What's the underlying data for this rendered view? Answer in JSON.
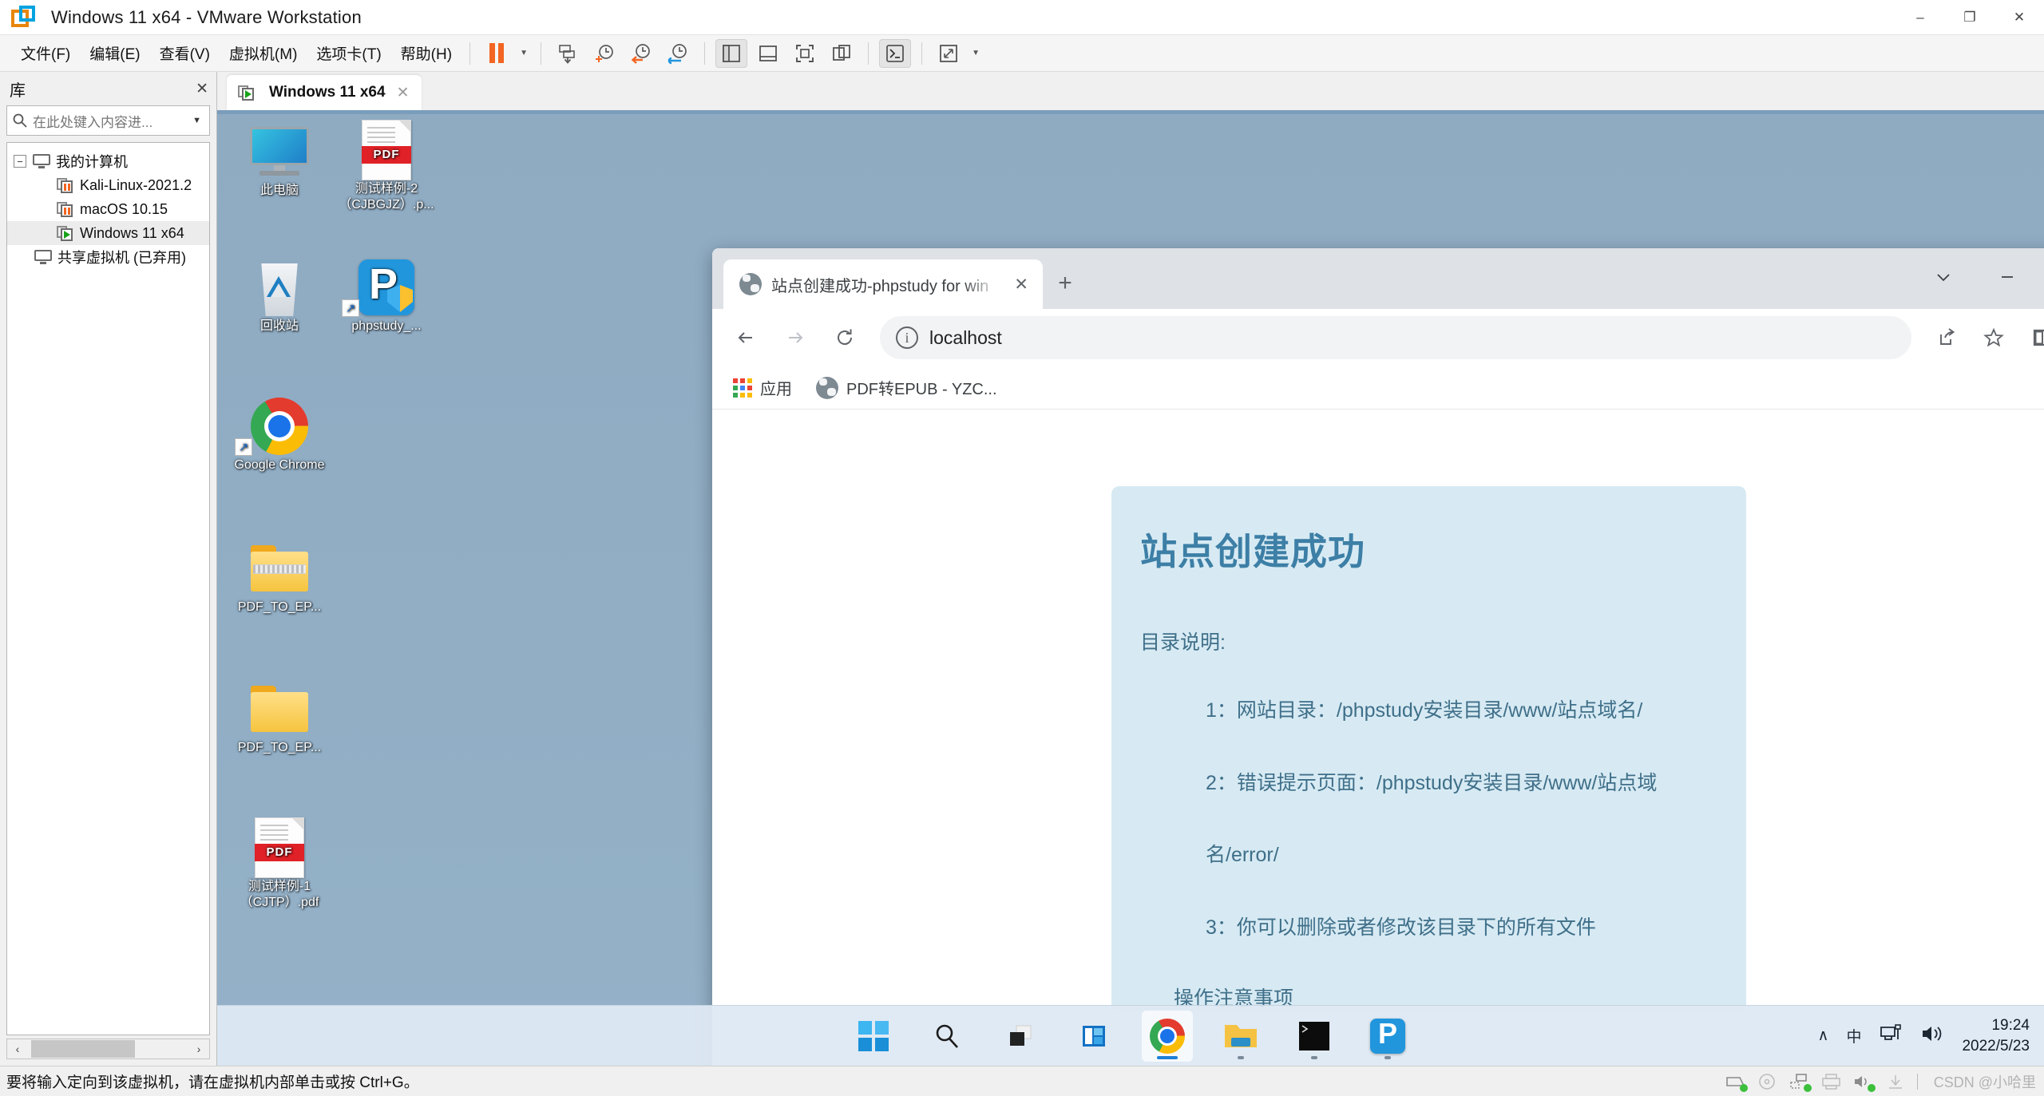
{
  "vmware": {
    "window_title": "Windows 11 x64 - VMware Workstation",
    "window_controls": {
      "minimize": "–",
      "maximize": "❐",
      "close": "✕"
    },
    "menus": [
      {
        "label": "文件(F)",
        "accel": "F"
      },
      {
        "label": "编辑(E)",
        "accel": "E"
      },
      {
        "label": "查看(V)",
        "accel": "V"
      },
      {
        "label": "虚拟机(M)",
        "accel": "M"
      },
      {
        "label": "选项卡(T)",
        "accel": "T"
      },
      {
        "label": "帮助(H)",
        "accel": "H"
      }
    ],
    "toolbar": [
      {
        "name": "suspend-button",
        "icon": "pause-icon"
      },
      {
        "name": "power-dropdown",
        "icon": "chevron-down-icon"
      },
      {
        "name": "snapshot-take-button",
        "icon": "snapshot-icon"
      },
      {
        "name": "snapshot-manager-button",
        "icon": "clock-plus-icon"
      },
      {
        "name": "revert-snapshot-button",
        "icon": "clock-back-icon"
      },
      {
        "name": "manage-snapshots-button",
        "icon": "clock-wrench-icon"
      },
      {
        "name": "show-library-button",
        "icon": "sidebar-panel-icon"
      },
      {
        "name": "show-thumbnail-bar-button",
        "icon": "bottom-panel-icon"
      },
      {
        "name": "fullscreen-button",
        "icon": "fullscreen-icon"
      },
      {
        "name": "unity-mode-button",
        "icon": "windows-overlap-icon"
      },
      {
        "name": "console-button",
        "icon": "terminal-icon"
      },
      {
        "name": "stretch-button",
        "icon": "expand-diagonal-icon"
      },
      {
        "name": "stretch-dropdown",
        "icon": "chevron-down-icon"
      }
    ],
    "library": {
      "title": "库",
      "close_label": "✕",
      "search_placeholder": "在此处键入内容进...",
      "tree": [
        {
          "label": "我的计算机",
          "type": "root",
          "expander": "−",
          "icon": "monitor-icon",
          "selected": false
        },
        {
          "label": "Kali-Linux-2021.2",
          "type": "vm",
          "state": "suspended",
          "icon": "vm-suspended-icon",
          "selected": false
        },
        {
          "label": "macOS 10.15",
          "type": "vm",
          "state": "suspended",
          "icon": "vm-suspended-icon",
          "selected": false
        },
        {
          "label": "Windows 11 x64",
          "type": "vm",
          "state": "running",
          "icon": "vm-running-icon",
          "selected": true
        },
        {
          "label": "共享虚拟机 (已弃用)",
          "type": "shared",
          "icon": "monitor-icon",
          "selected": false
        }
      ],
      "scroll_left": "‹",
      "scroll_right": "›"
    },
    "vm_tab": {
      "label": "Windows 11 x64",
      "close": "✕",
      "icon": "vm-running-icon"
    },
    "statusbar": {
      "message": "要将输入定向到该虚拟机，请在虚拟机内部单击或按 Ctrl+G。",
      "devices": [
        {
          "name": "harddisk-status-icon"
        },
        {
          "name": "cdrom-status-icon"
        },
        {
          "name": "network-status-icon"
        },
        {
          "name": "printer-status-icon"
        },
        {
          "name": "sound-status-icon"
        },
        {
          "name": "usb-status-icon"
        }
      ],
      "watermark": "CSDN @小哈里"
    }
  },
  "guest_desktop": {
    "icons": [
      {
        "label": "此电脑",
        "glyph": "computer-icon",
        "shortcut": false
      },
      {
        "label": "测试样例-2（CJBGJZ）.p...",
        "glyph": "pdf-file-icon",
        "shortcut": false
      },
      {
        "label": "回收站",
        "glyph": "recycle-bin-icon",
        "shortcut": false
      },
      {
        "label": "phpstudy_...",
        "glyph": "phpstudy-icon",
        "shortcut": true
      },
      {
        "label": "Google Chrome",
        "glyph": "chrome-icon",
        "shortcut": true
      },
      {
        "label": "PDF_TO_EP...",
        "glyph": "zip-folder-icon",
        "shortcut": false
      },
      {
        "label": "PDF_TO_EP...",
        "glyph": "folder-icon",
        "shortcut": false
      },
      {
        "label": "测试样例-1（CJTP）.pdf",
        "glyph": "pdf-file-icon",
        "shortcut": false
      }
    ],
    "taskbar": {
      "apps": [
        {
          "name": "start-button",
          "icon": "windows-logo-icon",
          "running": false,
          "active": false
        },
        {
          "name": "search-button",
          "icon": "search-icon",
          "running": false,
          "active": false
        },
        {
          "name": "task-view-button",
          "icon": "task-view-icon",
          "running": false,
          "active": false
        },
        {
          "name": "widgets-button",
          "icon": "widgets-icon",
          "running": false,
          "active": false
        },
        {
          "name": "taskbar-chrome",
          "icon": "chrome-icon",
          "running": true,
          "active": true
        },
        {
          "name": "taskbar-file-explorer",
          "icon": "file-explorer-icon",
          "running": true,
          "active": false
        },
        {
          "name": "taskbar-terminal",
          "icon": "terminal-icon",
          "running": true,
          "active": false
        },
        {
          "name": "taskbar-phpstudy",
          "icon": "phpstudy-icon",
          "running": true,
          "active": false
        }
      ],
      "tray": {
        "overflow": "∧",
        "ime": "中",
        "network_icon": "network-icon",
        "volume_icon": "volume-icon",
        "time": "19:24",
        "date": "2022/5/23"
      }
    }
  },
  "browser": {
    "tab": {
      "title": "站点创建成功-phpstudy for win",
      "favicon": "globe-icon",
      "close": "✕"
    },
    "new_tab_label": "+",
    "window_controls": {
      "tab_search": "∨",
      "minimize": "—",
      "maximize": "☐",
      "close": "✕"
    },
    "nav": {
      "back": "←",
      "forward": "→",
      "reload": "↻"
    },
    "omnibox": {
      "value": "localhost",
      "security_icon": "info-circle-icon"
    },
    "toolbar_icons": [
      {
        "name": "share-icon"
      },
      {
        "name": "bookmark-star-icon"
      },
      {
        "name": "side-panel-icon"
      },
      {
        "name": "profile-avatar-icon"
      },
      {
        "name": "chrome-menu-icon"
      }
    ],
    "bookmarks": [
      {
        "label": "应用",
        "icon": "apps-grid-icon"
      },
      {
        "label": "PDF转EPUB - YZC...",
        "icon": "globe-icon"
      }
    ]
  },
  "page": {
    "heading": "站点创建成功",
    "lead": "目录说明:",
    "items": [
      "1：网站目录：/phpstudy安装目录/www/站点域名/",
      "2：错误提示页面：/phpstudy安装目录/www/站点域",
      "名/error/",
      "3：你可以删除或者修改该目录下的所有文件"
    ],
    "cut_off_text": "操作注意事项"
  }
}
